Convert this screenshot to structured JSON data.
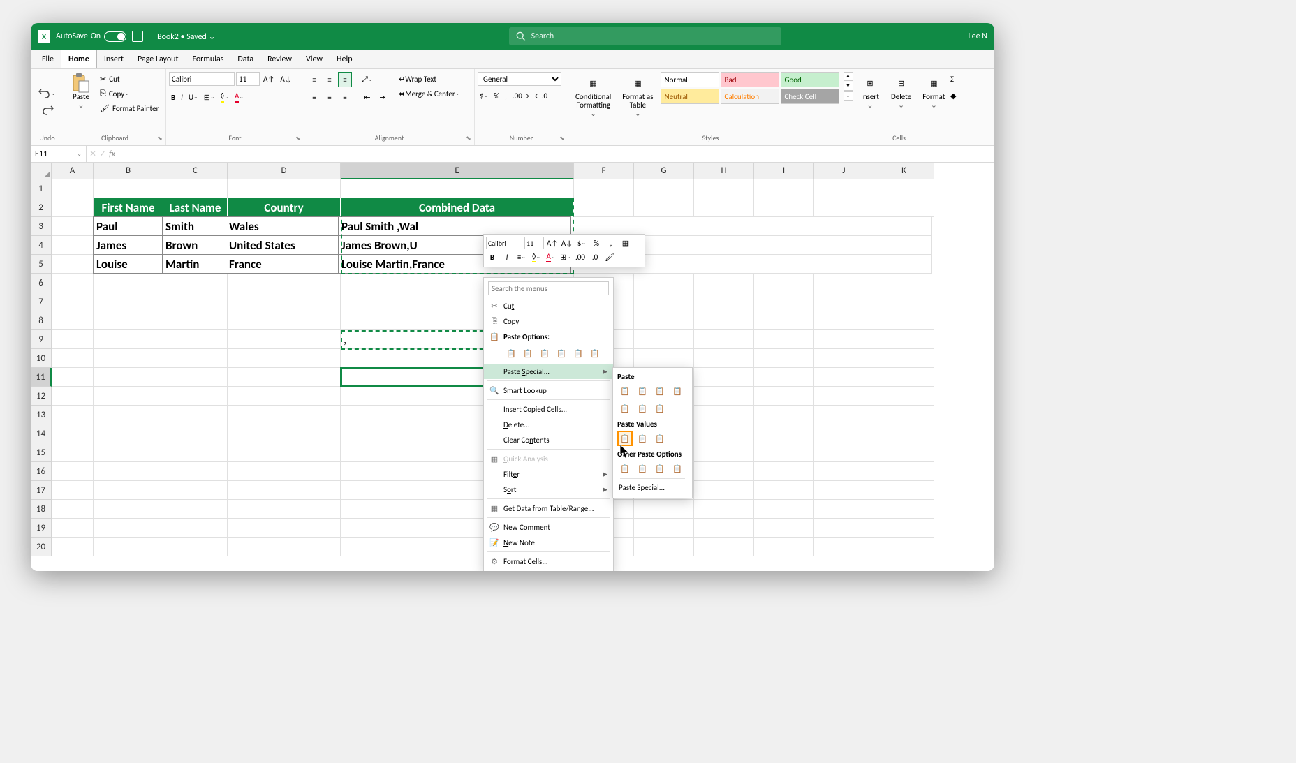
{
  "titlebar": {
    "autosave_label": "AutoSave",
    "autosave_state": "On",
    "book_name": "Book2 • Saved ⌄",
    "search_placeholder": "Search",
    "user_name": "Lee N"
  },
  "menu": {
    "file": "File",
    "home": "Home",
    "insert": "Insert",
    "page_layout": "Page Layout",
    "formulas": "Formulas",
    "data": "Data",
    "review": "Review",
    "view": "View",
    "help": "Help"
  },
  "ribbon": {
    "undo": {
      "label": "Undo"
    },
    "clipboard": {
      "label": "Clipboard",
      "paste": "Paste",
      "cut": "Cut",
      "copy": "Copy",
      "format_painter": "Format Painter"
    },
    "font": {
      "label": "Font",
      "font_name": "Calibri",
      "font_size": "11"
    },
    "alignment": {
      "label": "Alignment",
      "wrap": "Wrap Text",
      "merge": "Merge & Center"
    },
    "number": {
      "label": "Number",
      "format": "General"
    },
    "styles": {
      "label": "Styles",
      "cond_fmt": "Conditional\nFormatting",
      "fmt_table": "Format as\nTable",
      "normal": "Normal",
      "bad": "Bad",
      "good": "Good",
      "neutral": "Neutral",
      "calculation": "Calculation",
      "check": "Check Cell"
    },
    "cells": {
      "label": "Cells",
      "insert": "Insert",
      "delete": "Delete",
      "format": "Format"
    }
  },
  "namebox": {
    "ref": "E11"
  },
  "columns": [
    "A",
    "B",
    "C",
    "D",
    "E",
    "F",
    "G",
    "H",
    "I",
    "J",
    "K"
  ],
  "col_widths": {
    "A": 60,
    "B": 100,
    "C": 92,
    "D": 162,
    "E": 334,
    "F": 86,
    "G": 86,
    "H": 86,
    "I": 86,
    "J": 86,
    "K": 86
  },
  "rows_count": 20,
  "table": {
    "headers": [
      "First Name",
      "Last Name",
      "Country",
      "Combined Data"
    ],
    "rows": [
      {
        "first": "Paul",
        "last": "Smith",
        "country": "Wales",
        "combined": "Paul Smith ,Wal"
      },
      {
        "first": "James",
        "last": "Brown",
        "country": "United States",
        "combined": "James Brown,U"
      },
      {
        "first": "Louise",
        "last": "Martin",
        "country": "France",
        "combined": "Louise Martin,France"
      }
    ]
  },
  "cell_e9": ",",
  "mini_toolbar": {
    "font": "Calibri",
    "size": "11"
  },
  "context_menu": {
    "search_placeholder": "Search the menus",
    "cut": "Cut",
    "copy": "Copy",
    "paste_options": "Paste Options:",
    "paste_special": "Paste Special...",
    "smart_lookup": "Smart Lookup",
    "insert_copied": "Insert Copied Cells...",
    "delete": "Delete...",
    "clear_contents": "Clear Contents",
    "quick_analysis": "Quick Analysis",
    "filter": "Filter",
    "sort": "Sort",
    "get_data": "Get Data from Table/Range...",
    "new_comment": "New Comment",
    "new_note": "New Note",
    "format_cells": "Format Cells..."
  },
  "paste_submenu": {
    "paste": "Paste",
    "paste_values": "Paste Values",
    "other": "Other Paste Options",
    "paste_special": "Paste Special..."
  }
}
